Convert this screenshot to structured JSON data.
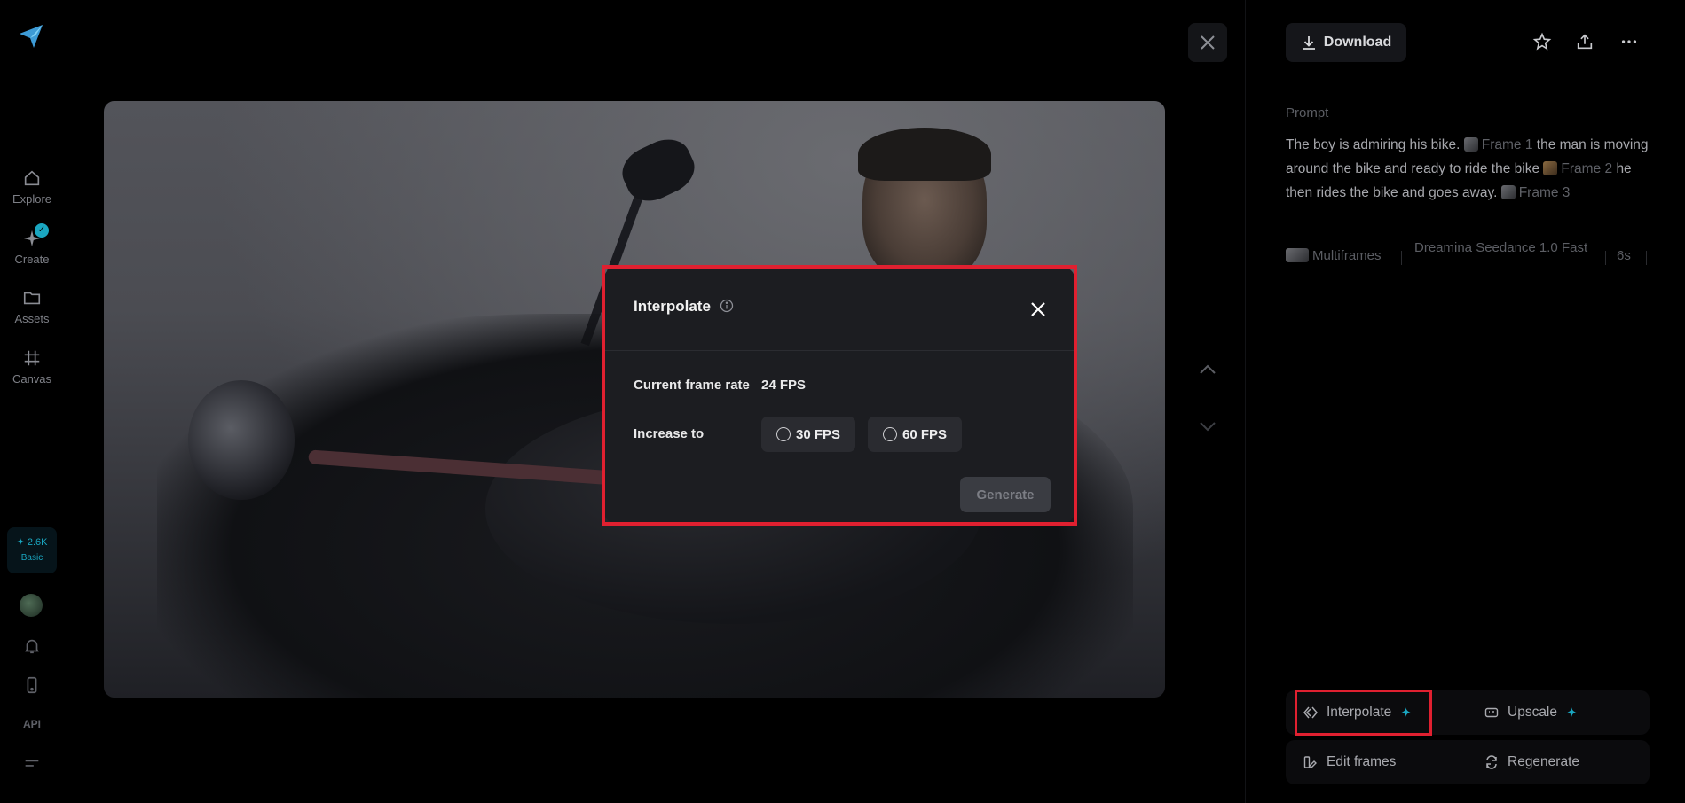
{
  "sidebar": {
    "items": [
      {
        "label": "Explore",
        "icon": "home-icon"
      },
      {
        "label": "Create",
        "icon": "sparkle-icon"
      },
      {
        "label": "Assets",
        "icon": "folder-icon"
      },
      {
        "label": "Canvas",
        "icon": "canvas-icon"
      }
    ],
    "credits": "✦ 2.6K",
    "plan": "Basic",
    "api_label": "API"
  },
  "modal": {
    "title": "Interpolate",
    "current_label": "Current frame rate",
    "current_value": "24 FPS",
    "increase_label": "Increase to",
    "options": [
      "30 FPS",
      "60 FPS"
    ],
    "generate_label": "Generate"
  },
  "panel": {
    "download_label": "Download",
    "prompt_label": "Prompt",
    "prompt_parts": {
      "p1": "The boy is admiring his bike.",
      "f1": "Frame 1",
      "p2": "the man is moving around the bike and ready to ride the bike",
      "f2": "Frame 2",
      "p3": "he then rides the bike and goes away.",
      "f3": "Frame 3"
    },
    "meta": {
      "mode": "Multiframes",
      "model": "Dreamina Seedance 1.0 Fast",
      "duration": "6s"
    },
    "actions": {
      "interpolate": "Interpolate",
      "upscale": "Upscale",
      "edit_frames": "Edit frames",
      "regenerate": "Regenerate"
    }
  },
  "colors": {
    "accent": "#1aa6c0",
    "highlight": "#e02030"
  }
}
